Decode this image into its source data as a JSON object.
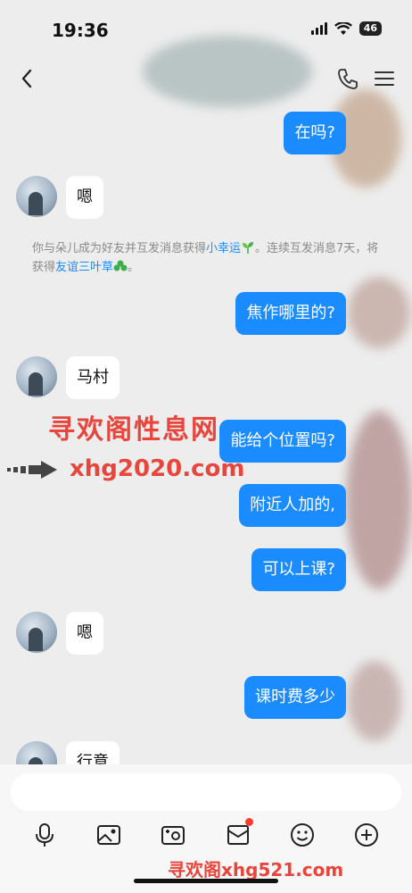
{
  "status_bar": {
    "time": "19:36",
    "battery": "46"
  },
  "nav": {
    "back_icon": "chevron-left-icon",
    "call_icon": "phone-icon",
    "menu_icon": "menu-icon"
  },
  "messages": [
    {
      "side": "out",
      "text": "在吗?"
    },
    {
      "side": "in",
      "text": "嗯"
    },
    {
      "side": "out",
      "text": "焦作哪里的?"
    },
    {
      "side": "in",
      "text": "马村"
    },
    {
      "side": "out",
      "text": "能给个位置吗?"
    },
    {
      "side": "out",
      "text": "附近人加的,"
    },
    {
      "side": "out",
      "text": "可以上课?"
    },
    {
      "side": "in",
      "text": "嗯"
    },
    {
      "side": "out",
      "text": "课时费多少"
    },
    {
      "side": "in",
      "text": "行意"
    }
  ],
  "system_message": {
    "part1": "你与朵儿成为好友并互发消息获得",
    "link1": "小幸运",
    "part2": "。连续互发消息7天，将获得",
    "link2": "友谊三叶草",
    "part3": "。"
  },
  "watermarks": {
    "line1": "寻欢阁性息网",
    "line2": "xhg2020.com",
    "line3": "寻欢阁xhg521.com"
  },
  "composer": {
    "placeholder": ""
  },
  "colors": {
    "accent": "#1a8cff",
    "watermark": "#e8453c",
    "badge": "#ff3b30"
  }
}
